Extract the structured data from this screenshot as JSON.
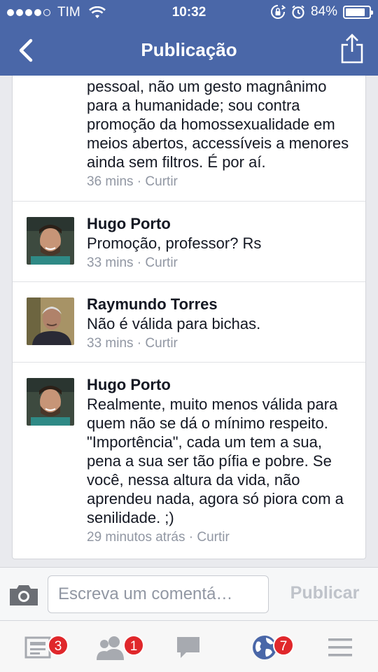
{
  "status_bar": {
    "carrier": "TIM",
    "time": "10:32",
    "battery": "84%",
    "battery_level": 0.84
  },
  "nav": {
    "title": "Publicação"
  },
  "comments": [
    {
      "name": "",
      "text": "pessoal, não um gesto magnânimo para a humanidade; sou contra promoção da homossexualidade em meios abertos, accessíveis a menores ainda sem filtros. É por aí.",
      "time": "36 mins",
      "separator": " · ",
      "like": "Curtir"
    },
    {
      "name": "Hugo Porto",
      "text": "Promoção, professor? Rs",
      "time": "33 mins",
      "separator": " · ",
      "like": "Curtir"
    },
    {
      "name": "Raymundo Torres",
      "text": "Não é válida para bichas.",
      "time": "33 mins",
      "separator": " · ",
      "like": "Curtir"
    },
    {
      "name": "Hugo Porto",
      "text": "Realmente, muito menos válida para quem não se dá o mínimo respeito. \"Importência\", cada um tem a sua, pena a sua ser tão pífia e pobre. Se você, nessa altura da vida, não aprendeu nada, agora só piora com a senilidade. ;)",
      "time": "29 minutos atrás",
      "separator": " · ",
      "like": "Curtir"
    }
  ],
  "composer": {
    "placeholder": "Escreva um comentá…",
    "publish_label": "Publicar"
  },
  "tabbar": {
    "news_feed_badge": "3",
    "friend_requests_badge": "1",
    "notifications_badge": "7"
  },
  "colors": {
    "header": "#4a67a8",
    "badge": "#e0272b",
    "meta_text": "#9197a3",
    "globe_icon": "#4a67a8"
  }
}
